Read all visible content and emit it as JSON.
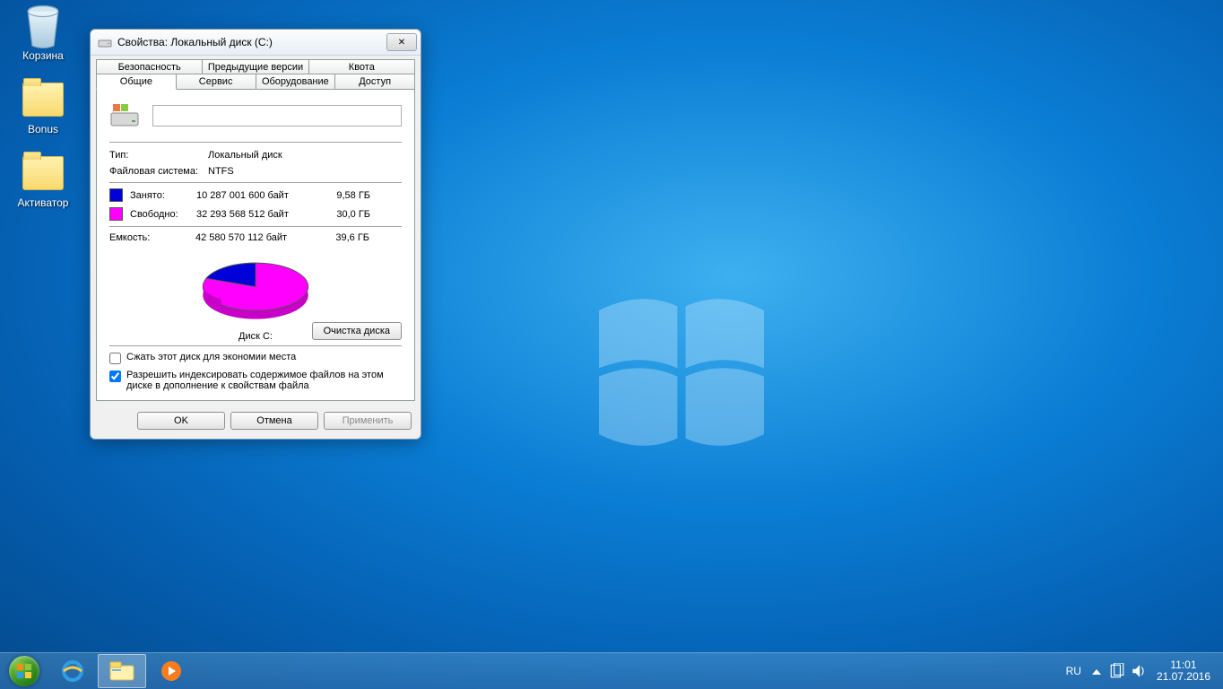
{
  "desktop": {
    "icons": [
      {
        "label": "Корзина",
        "kind": "bin"
      },
      {
        "label": "Bonus",
        "kind": "folder"
      },
      {
        "label": "Активатор",
        "kind": "folder"
      }
    ]
  },
  "taskbar": {
    "lang": "RU",
    "time": "11:01",
    "date": "21.07.2016"
  },
  "window": {
    "title": "Свойства: Локальный диск (C:)",
    "tabs_top": [
      "Безопасность",
      "Предыдущие версии",
      "Квота"
    ],
    "tabs_bottom": [
      "Общие",
      "Сервис",
      "Оборудование",
      "Доступ"
    ],
    "active_tab": "Общие",
    "type_label": "Тип:",
    "type_value": "Локальный диск",
    "fs_label": "Файловая система:",
    "fs_value": "NTFS",
    "used_label": "Занято:",
    "used_bytes": "10 287 001 600 байт",
    "used_gb": "9,58 ГБ",
    "used_color": "#0000d8",
    "free_label": "Свободно:",
    "free_bytes": "32 293 568 512 байт",
    "free_gb": "30,0 ГБ",
    "free_color": "#ff00ff",
    "cap_label": "Емкость:",
    "cap_bytes": "42 580 570 112 байт",
    "cap_gb": "39,6 ГБ",
    "disk_label": "Диск C:",
    "cleanup_btn": "Очистка диска",
    "compress_cb": "Сжать этот диск для экономии места",
    "compress_checked": false,
    "index_cb": "Разрешить индексировать содержимое файлов на этом диске в дополнение к свойствам файла",
    "index_checked": true,
    "ok": "OK",
    "cancel": "Отмена",
    "apply": "Применить"
  },
  "chart_data": {
    "type": "pie",
    "title": "Диск C:",
    "series": [
      {
        "name": "Занято",
        "value": 10287001600,
        "color": "#0000d8"
      },
      {
        "name": "Свободно",
        "value": 32293568512,
        "color": "#ff00ff"
      }
    ]
  }
}
